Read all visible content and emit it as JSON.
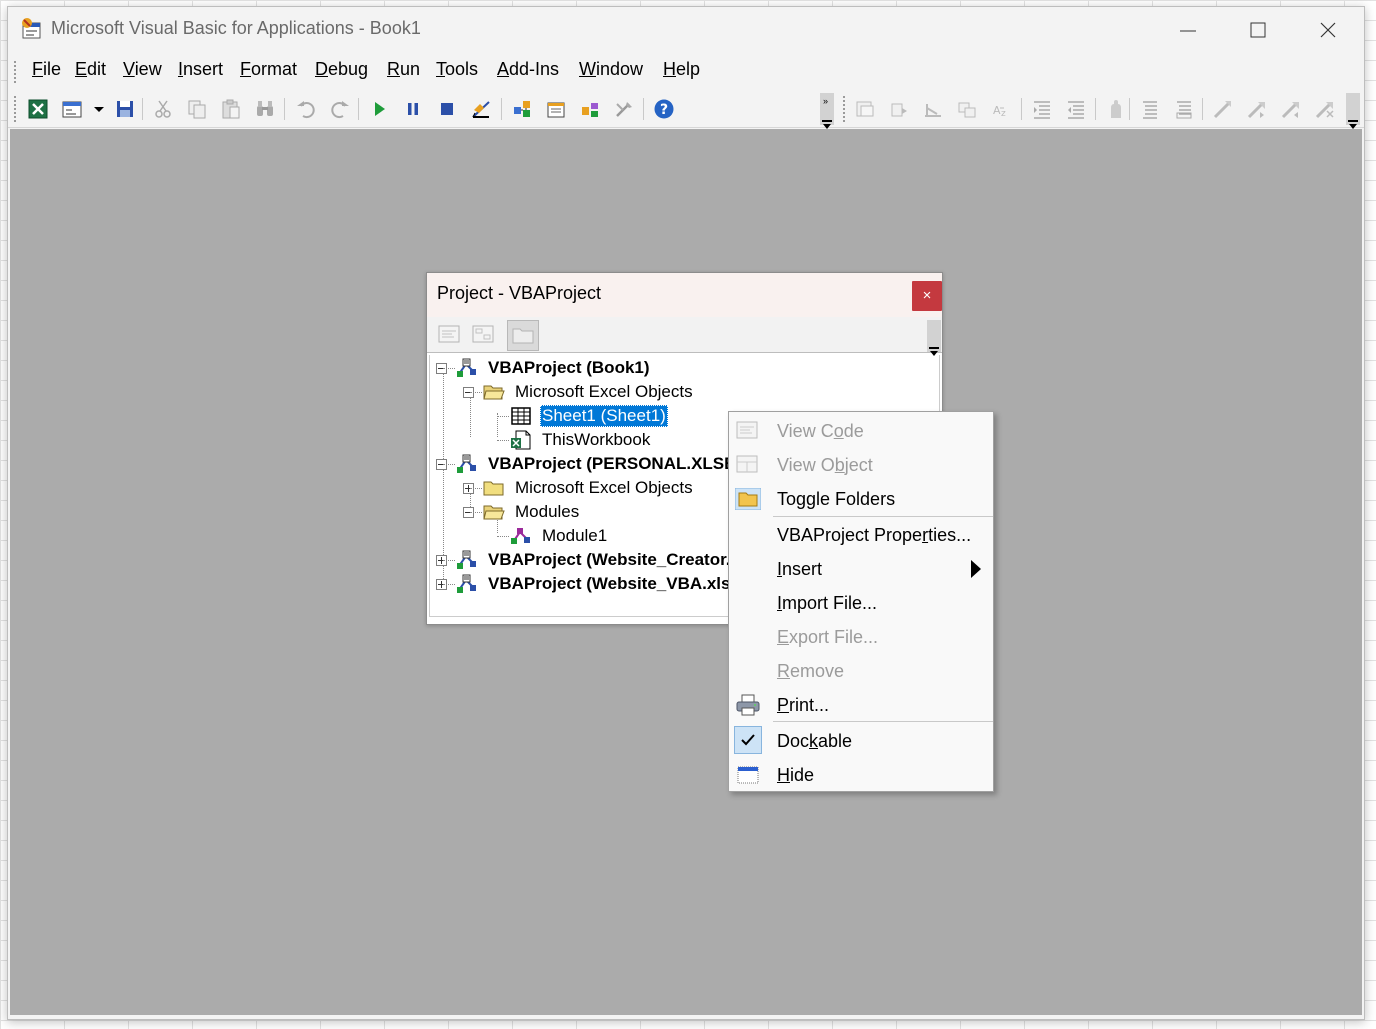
{
  "window": {
    "title": "Microsoft Visual Basic for Applications - Book1"
  },
  "menubar": [
    {
      "label": "File",
      "hotkey": "F",
      "rest": "ile"
    },
    {
      "label": "Edit",
      "hotkey": "E",
      "rest": "dit"
    },
    {
      "label": "View",
      "hotkey": "V",
      "rest": "iew"
    },
    {
      "label": "Insert",
      "hotkey": "I",
      "rest": "nsert"
    },
    {
      "label": "Format",
      "hotkey": "F",
      "rest": "ormat"
    },
    {
      "label": "Debug",
      "hotkey": "D",
      "rest": "ebug"
    },
    {
      "label": "Run",
      "hotkey": "R",
      "rest": "un"
    },
    {
      "label": "Tools",
      "hotkey": "T",
      "rest": "ools"
    },
    {
      "label": "Add-Ins",
      "hotkey": "A",
      "rest": "dd-Ins"
    },
    {
      "label": "Window",
      "hotkey": "W",
      "rest": "indow"
    },
    {
      "label": "Help",
      "hotkey": "H",
      "rest": "elp"
    }
  ],
  "toolbar": {
    "standard": [
      "excel-view-icon",
      "insert-userform-icon",
      "dropdown-arrow-icon",
      "save-icon",
      "cut-icon",
      "copy-icon",
      "paste-icon",
      "find-icon",
      "undo-icon",
      "redo-icon",
      "run-icon",
      "break-icon",
      "reset-icon",
      "design-mode-icon",
      "project-explorer-icon",
      "properties-window-icon",
      "object-browser-icon",
      "toolbox-icon",
      "help-icon"
    ],
    "edit": [
      "list-properties-icon",
      "list-constants-icon",
      "quick-info-icon",
      "parameter-info-icon",
      "complete-word-icon",
      "indent-icon",
      "outdent-icon",
      "toggle-breakpoint-icon",
      "comment-block-icon",
      "uncomment-block-icon",
      "toggle-bookmark-icon",
      "next-bookmark-icon",
      "previous-bookmark-icon",
      "clear-bookmarks-icon"
    ]
  },
  "project_panel": {
    "title": "Project - VBAProject",
    "close": "×",
    "tools": [
      "view-code-icon",
      "view-object-icon",
      "toggle-folders-icon"
    ],
    "tree": [
      {
        "label": "VBAProject (Book1)",
        "bold": true
      },
      {
        "label": "Microsoft Excel Objects"
      },
      {
        "label": "Sheet1 (Sheet1)",
        "selected": true
      },
      {
        "label": "ThisWorkbook"
      },
      {
        "label": "VBAProject (PERSONAL.XLSB)",
        "bold": true
      },
      {
        "label": "Microsoft Excel Objects"
      },
      {
        "label": "Modules"
      },
      {
        "label": "Module1"
      },
      {
        "label": "VBAProject (Website_Creator.xlsm)",
        "bold": true
      },
      {
        "label": "VBAProject (Website_VBA.xlsm)",
        "bold": true
      }
    ]
  },
  "context_menu": [
    {
      "label": "View Code",
      "pre": "View C",
      "hot": "o",
      "post": "de",
      "enabled": false,
      "icon": "view-code-icon"
    },
    {
      "label": "View Object",
      "pre": "View O",
      "hot": "b",
      "post": "ject",
      "enabled": false,
      "icon": "view-object-icon"
    },
    {
      "label": "Toggle Folders",
      "pre": "Toggle Folders",
      "hot": "",
      "post": "",
      "enabled": true,
      "icon": "folder-icon"
    },
    {
      "label": "VBAProject Properties...",
      "pre": "VBAProject Prope",
      "hot": "r",
      "post": "ties...",
      "enabled": true
    },
    {
      "label": "Insert",
      "pre": "",
      "hot": "I",
      "post": "nsert",
      "enabled": true,
      "submenu": true
    },
    {
      "label": "Import File...",
      "pre": "",
      "hot": "I",
      "post": "mport File...",
      "enabled": true
    },
    {
      "label": "Export File...",
      "pre": "",
      "hot": "E",
      "post": "xport File...",
      "enabled": false
    },
    {
      "label": "Remove",
      "pre": "",
      "hot": "R",
      "post": "emove",
      "enabled": false
    },
    {
      "label": "Print...",
      "pre": "",
      "hot": "P",
      "post": "rint...",
      "enabled": true,
      "icon": "printer-icon"
    },
    {
      "label": "Dockable",
      "pre": "Doc",
      "hot": "k",
      "post": "able",
      "enabled": true,
      "checked": true
    },
    {
      "label": "Hide",
      "pre": "",
      "hot": "H",
      "post": "ide",
      "enabled": true,
      "icon": "hide-window-icon"
    }
  ]
}
